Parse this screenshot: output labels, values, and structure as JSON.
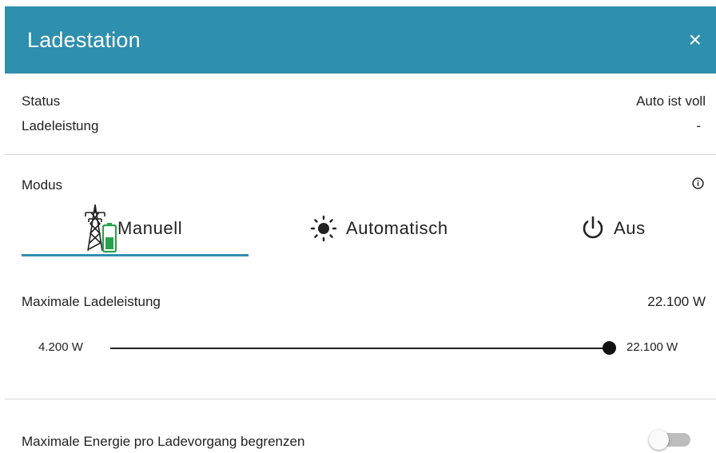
{
  "dialog": {
    "title": "Ladestation",
    "close_label": "×"
  },
  "status_section": {
    "status_label": "Status",
    "status_value": "Auto ist voll",
    "power_label": "Ladeleistung",
    "power_value": "-"
  },
  "mode_section": {
    "label": "Modus",
    "info_icon": "info-icon",
    "selected_tab": "Manuell",
    "tabs": [
      {
        "label": "Manuell",
        "icon": "power-tower-battery-icon"
      },
      {
        "label": "Automatisch",
        "icon": "sun-icon"
      },
      {
        "label": "Aus",
        "icon": "power-icon"
      }
    ],
    "accent_color": "#2e8fae"
  },
  "max_power": {
    "label": "Maximale Ladeleistung",
    "value": "22.100 W",
    "slider_min_label": "4.200 W",
    "slider_max_label": "22.100 W",
    "slider_fraction": 1.0
  },
  "energy_limit": {
    "label": "Maximale Energie pro Ladevorgang begrenzen",
    "enabled": false
  }
}
